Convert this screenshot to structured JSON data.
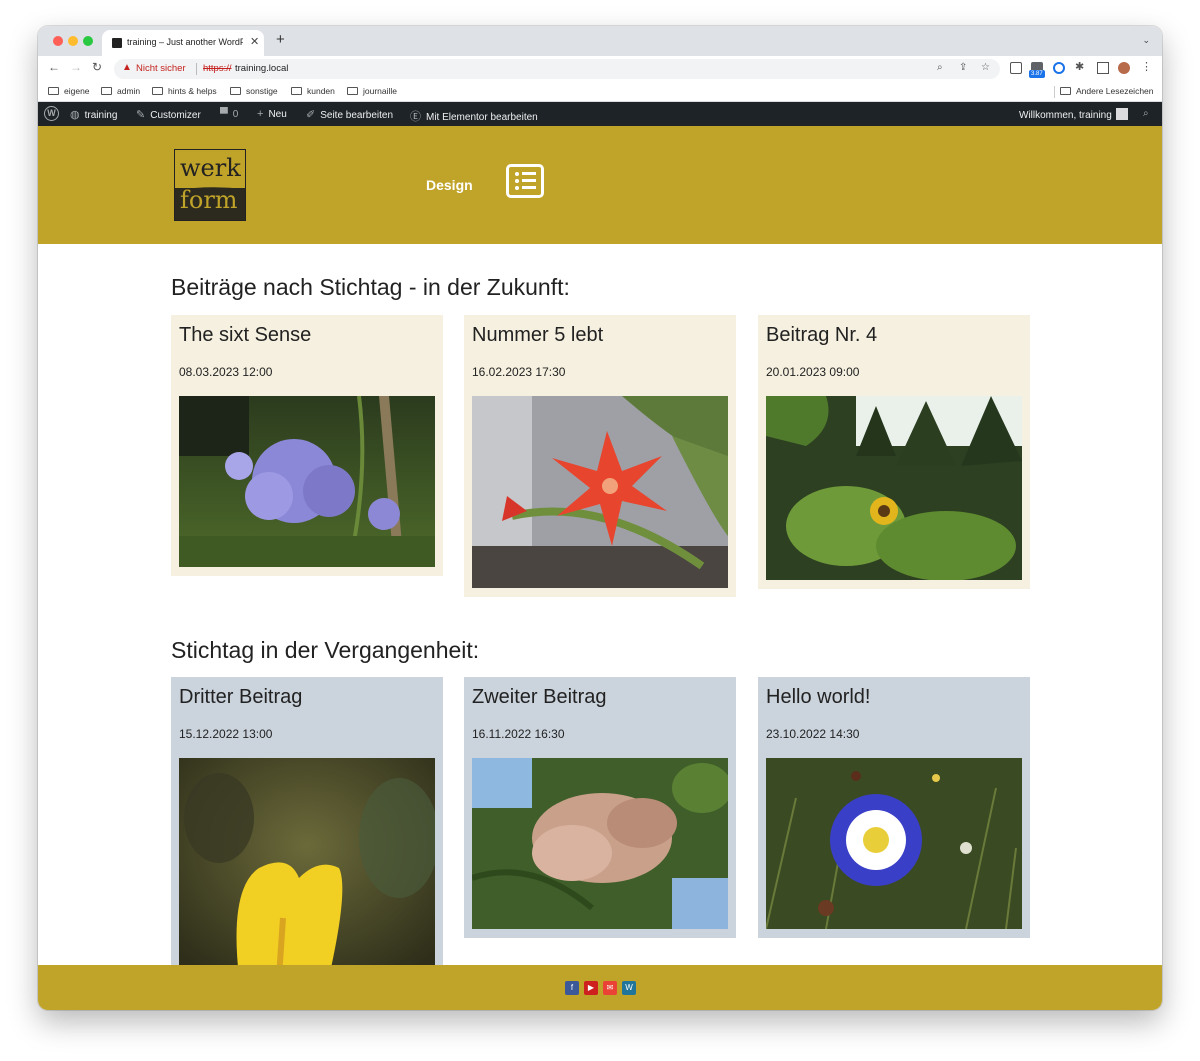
{
  "browser": {
    "tab_title": "training – Just another WordPr",
    "url_warning": "Nicht sicher",
    "url_scheme": "https://",
    "url_host": "training.local",
    "extension_badge": "3.87",
    "bookmarks": [
      "eigene",
      "admin",
      "hints & helps",
      "sonstige",
      "kunden",
      "journaille"
    ],
    "other_bookmarks": "Andere Lesezeichen"
  },
  "adminbar": {
    "site_name": "training",
    "customizer": "Customizer",
    "comments": "0",
    "new": "Neu",
    "edit_page": "Seite bearbeiten",
    "elementor": "Mit Elementor bearbeiten",
    "greeting": "Willkommen, training"
  },
  "site": {
    "logo_top": "werk",
    "logo_bottom": "form",
    "nav_design": "Design",
    "future_heading": "Beiträge nach Stichtag - in der Zukunft:",
    "past_heading": "Stichtag in der Vergangenheit:",
    "future_posts": [
      {
        "title": "The sixt Sense",
        "date": "08.03.2023 12:00",
        "image": "agapanthus-flower-photo"
      },
      {
        "title": "Nummer 5 lebt",
        "date": "16.02.2023 17:30",
        "image": "red-cactus-flower-photo"
      },
      {
        "title": "Beitrag Nr. 4",
        "date": "20.01.2023 09:00",
        "image": "sunflower-forest-photo"
      }
    ],
    "past_posts": [
      {
        "title": "Dritter Beitrag",
        "date": "15.12.2022 13:00",
        "image": "yellow-calla-photo"
      },
      {
        "title": "Zweiter Beitrag",
        "date": "16.11.2022 16:30",
        "image": "maple-seeds-photo"
      },
      {
        "title": "Hello world!",
        "date": "23.10.2022 14:30",
        "image": "blue-morning-glory-photo"
      }
    ],
    "footer_social": [
      {
        "name": "facebook-icon",
        "color": "#3b5998"
      },
      {
        "name": "youtube-icon",
        "color": "#cd201f"
      },
      {
        "name": "email-icon",
        "color": "#ea4335"
      },
      {
        "name": "wordpress-icon",
        "color": "#21759b"
      }
    ]
  },
  "colors": {
    "header_gold": "#c0a329",
    "future_card": "#f5f0df",
    "past_card": "#cbd4dd",
    "adminbar": "#1d2327"
  }
}
